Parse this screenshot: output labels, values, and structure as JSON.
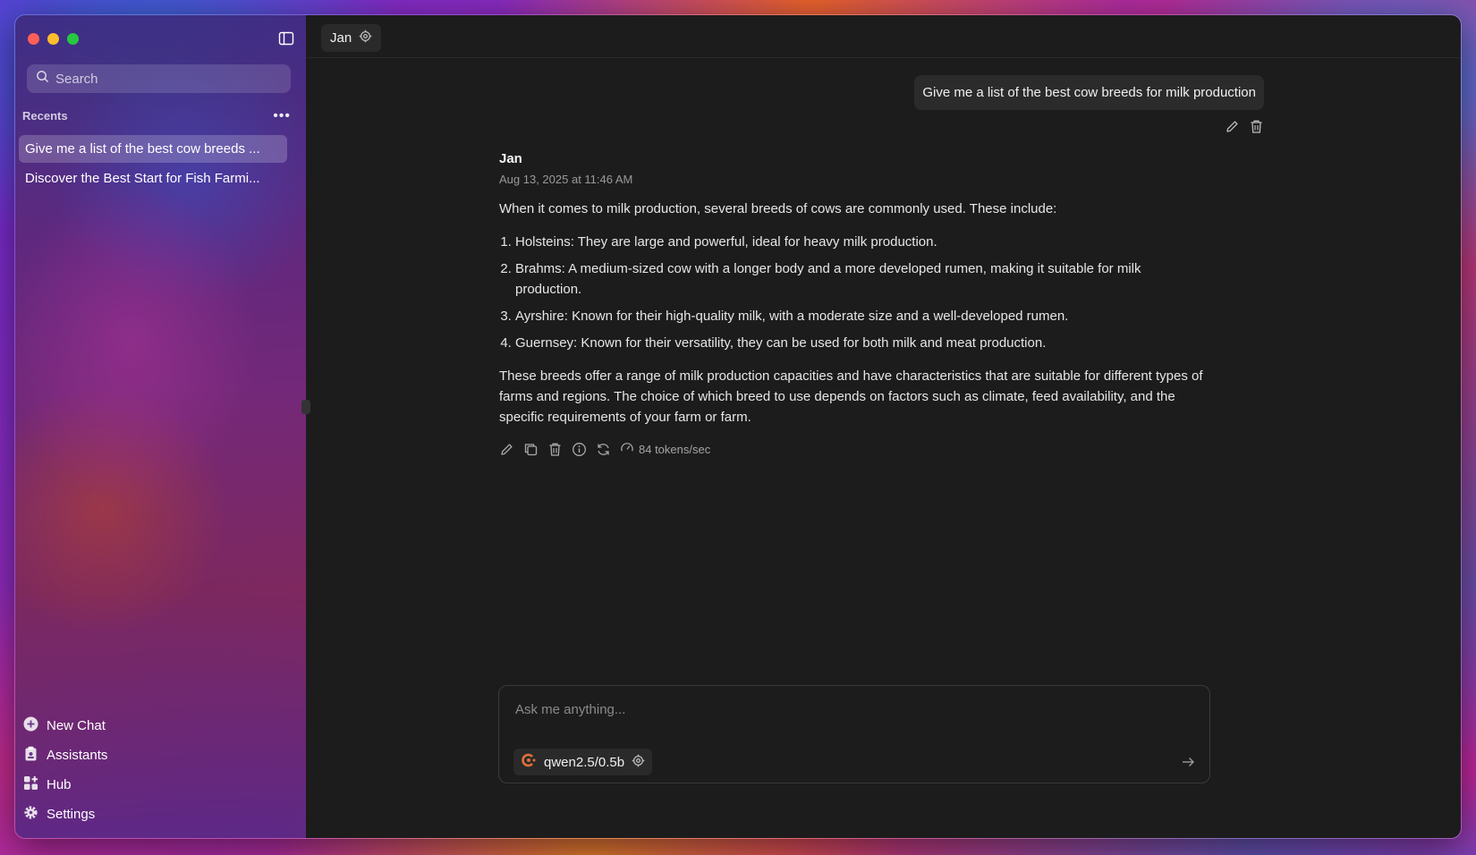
{
  "sidebar": {
    "search_placeholder": "Search",
    "recents_label": "Recents",
    "more_label": "•••",
    "recents": [
      {
        "label": "Give me a list of the best cow breeds ..."
      },
      {
        "label": "Discover the Best Start for Fish Farmi..."
      }
    ],
    "nav": [
      {
        "label": "New Chat",
        "icon": "plus-circle-icon"
      },
      {
        "label": "Assistants",
        "icon": "clipboard-icon"
      },
      {
        "label": "Hub",
        "icon": "grid-plus-icon"
      },
      {
        "label": "Settings",
        "icon": "gear-icon"
      }
    ]
  },
  "header": {
    "assistant_name": "Jan"
  },
  "chat": {
    "user_message": "Give me a list of the best cow breeds for milk production",
    "reply": {
      "author": "Jan",
      "timestamp": "Aug 13, 2025 at 11:46 AM",
      "intro": "When it comes to milk production, several breeds of cows are commonly used. These include:",
      "items": [
        "Holsteins: They are large and powerful, ideal for heavy milk production.",
        "Brahms: A medium-sized cow with a longer body and a more developed rumen, making it suitable for milk production.",
        "Ayrshire: Known for their high-quality milk, with a moderate size and a well-developed rumen.",
        "Guernsey: Known for their versatility, they can be used for both milk and meat production."
      ],
      "outro": "These breeds offer a range of milk production capacities and have characteristics that are suitable for different types of farms and regions. The choice of which breed to use depends on factors such as climate, feed availability, and the specific requirements of your farm or farm.",
      "tokens_rate": "84 tokens/sec"
    }
  },
  "composer": {
    "placeholder": "Ask me anything...",
    "model": "qwen2.5/0.5b"
  },
  "colors": {
    "main_bg": "#1c1c1c",
    "bubble_bg": "#2b2b2b",
    "traffic_red": "#fe5f57",
    "traffic_yellow": "#febc2e",
    "traffic_green": "#28c840"
  }
}
